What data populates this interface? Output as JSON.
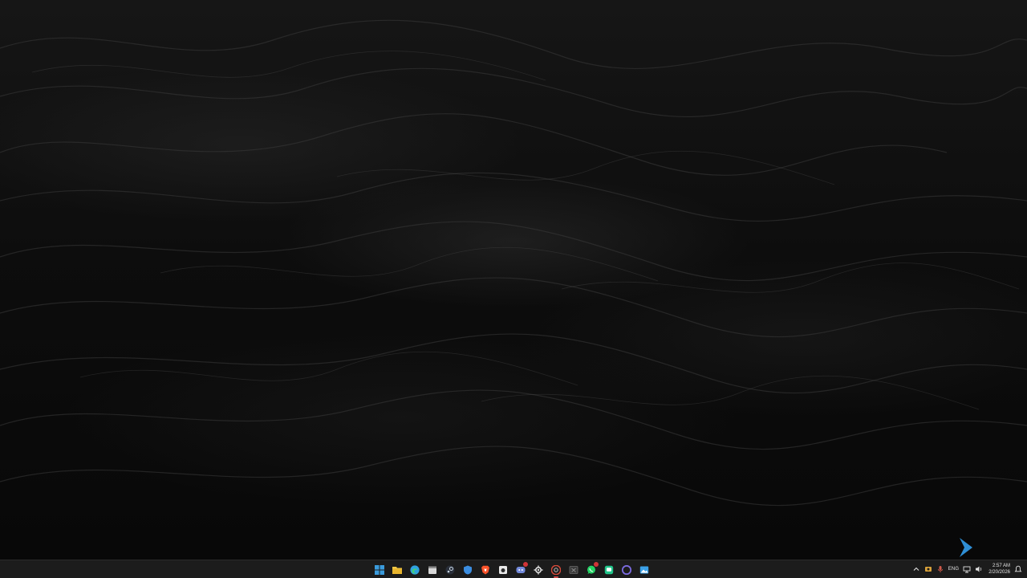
{
  "taskbar": {
    "apps": [
      {
        "name": "start-icon",
        "color": "#3a9bdc"
      },
      {
        "name": "file-explorer-icon",
        "color": "#f2c744"
      },
      {
        "name": "edge-browser-icon",
        "color": "#2fa1e0"
      },
      {
        "name": "calendar-app-icon",
        "color": "#d8d8d8"
      },
      {
        "name": "steam-icon",
        "color": "#c7d5e0"
      },
      {
        "name": "shield-app-icon",
        "color": "#3b8de0"
      },
      {
        "name": "brave-browser-icon",
        "color": "#fb542b"
      },
      {
        "name": "camera-app-icon",
        "color": "#e8e8e8"
      },
      {
        "name": "discord-icon",
        "color": "#7289da"
      },
      {
        "name": "settings-gear-icon",
        "color": "#e0e0e0"
      },
      {
        "name": "chrome-browser-icon",
        "color": "#d84a3a"
      },
      {
        "name": "excel-icon",
        "color": "#6b6b6b"
      },
      {
        "name": "whatsapp-icon",
        "color": "#25d366"
      },
      {
        "name": "messaging-app-icon",
        "color": "#21c58a"
      },
      {
        "name": "circle-app-icon",
        "color": "#7b6be0"
      },
      {
        "name": "image-viewer-icon",
        "color": "#3aa0e8"
      }
    ]
  },
  "tray": {
    "language": "ENG",
    "time": "2:57 AM",
    "date": "2/20/2026"
  },
  "colors": {
    "taskbar_bg": "#1c1c1c",
    "accent": "#2f8fd6"
  }
}
